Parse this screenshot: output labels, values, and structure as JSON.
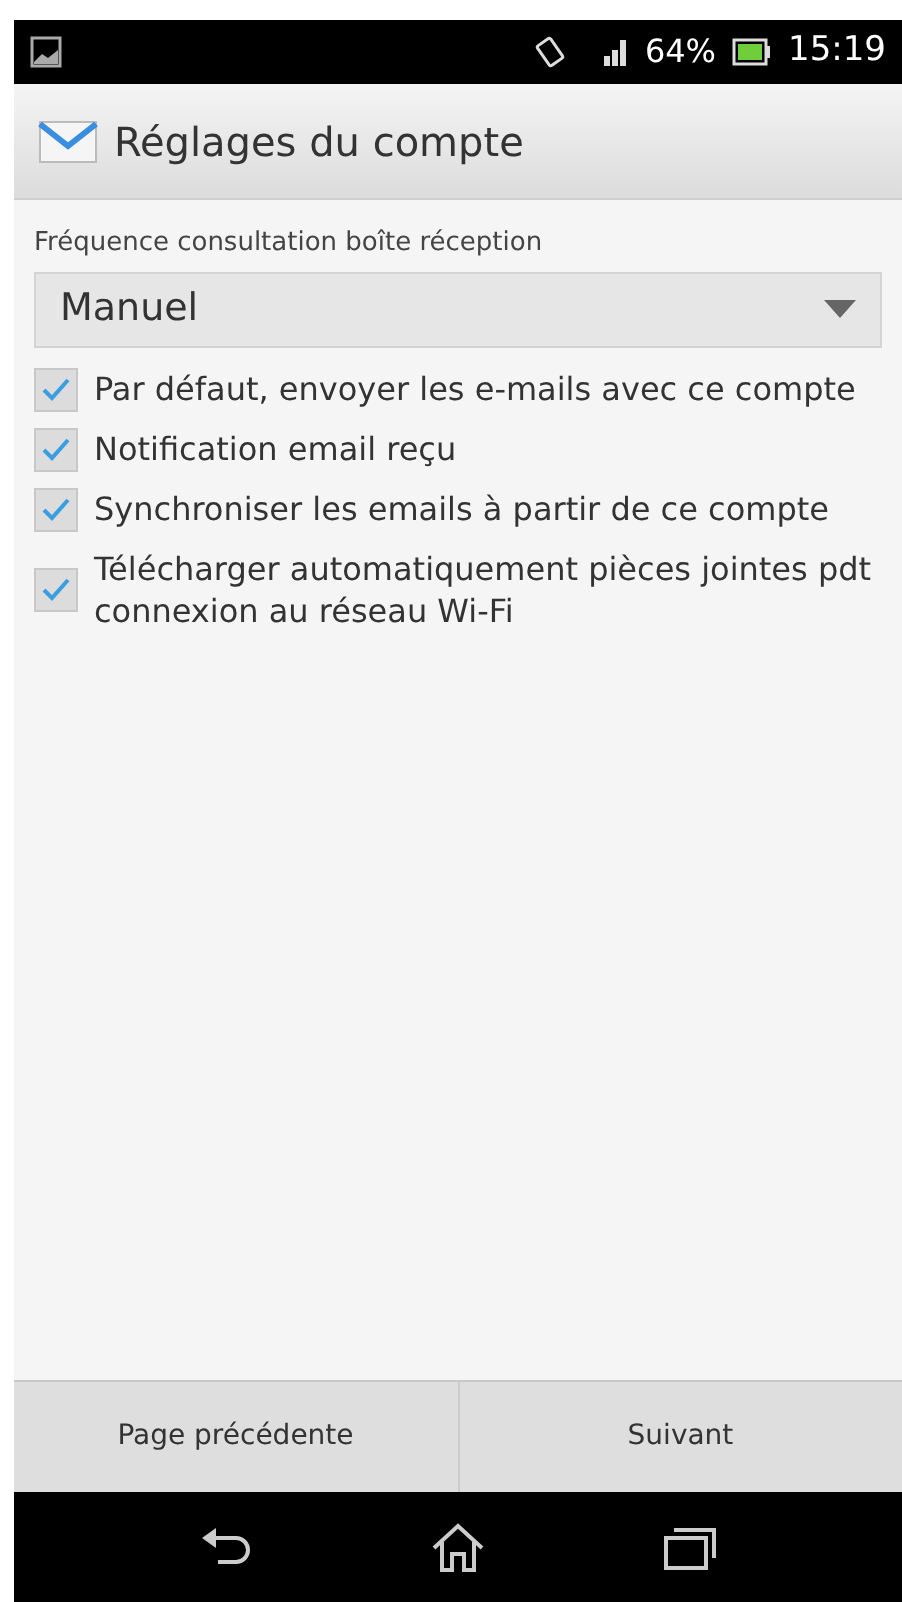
{
  "status_bar": {
    "battery": "64%",
    "time": "15:19"
  },
  "header": {
    "title": "Réglages du compte"
  },
  "frequency": {
    "label": "Fréquence consultation boîte réception",
    "value": "Manuel"
  },
  "options": [
    {
      "label": "Par défaut, envoyer les e-mails avec ce compte",
      "checked": true
    },
    {
      "label": "Notification email reçu",
      "checked": true
    },
    {
      "label": "Synchroniser les emails à partir de ce compte",
      "checked": true
    },
    {
      "label": "Télécharger automatiquement pièces jointes pdt connexion au réseau Wi-Fi",
      "checked": true
    }
  ],
  "buttons": [
    "Page précédente",
    "Suivant"
  ]
}
